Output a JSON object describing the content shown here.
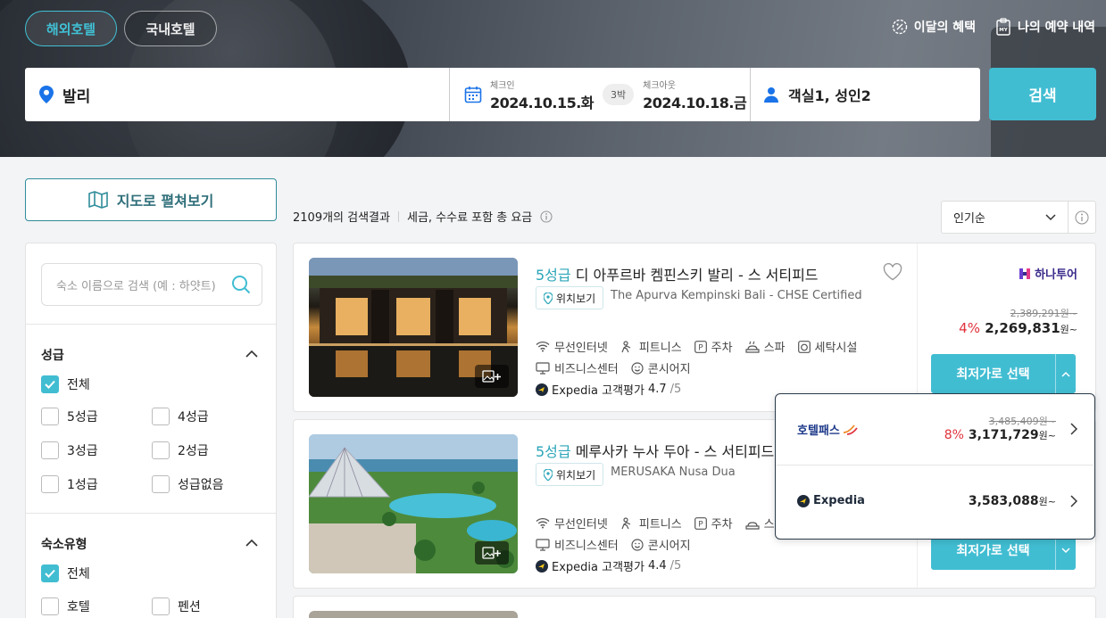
{
  "tabs": [
    {
      "label": "해외호텔",
      "active": true
    },
    {
      "label": "국내호텔",
      "active": false
    }
  ],
  "top_links": {
    "benefits": "이달의 혜택",
    "reservations": "나의 예약 내역",
    "reservations_icon_text": "MY"
  },
  "search": {
    "destination": "발리",
    "checkin_label": "체크인",
    "checkin": "2024.10.15.화",
    "nights": "3박",
    "checkout_label": "체크아웃",
    "checkout": "2024.10.18.금",
    "guests": "객실1, 성인2",
    "button": "검색"
  },
  "map_button": "지도로 펼쳐보기",
  "filters": {
    "name_placeholder": "숙소 이름으로 검색 (예 : 하얏트)",
    "grade": {
      "title": "성급",
      "options": [
        "전체",
        "5성급",
        "4성급",
        "3성급",
        "2성급",
        "1성급",
        "성급없음"
      ]
    },
    "type": {
      "title": "숙소유형",
      "options": [
        "전체",
        "호텔",
        "펜션"
      ]
    }
  },
  "results": {
    "count": "2109개의 검색결과",
    "price_note": "세금, 수수료 포함 총 요금",
    "sort": "인기순"
  },
  "hotels": [
    {
      "grade": "5성급",
      "name": " 디 아푸르바 켐핀스키 발리 - 스 서티피드",
      "map_chip": "위치보기",
      "english_name": "The Apurva Kempinski Bali - CHSE Certified",
      "amenities_row1": [
        "무선인터넷",
        "피트니스",
        "주차",
        "스파",
        "세탁시설"
      ],
      "amenities_row2": [
        "비즈니스센터",
        "콘시어지"
      ],
      "rating_source": "Expedia 고객평가",
      "rating": "4.7",
      "rating_max": "/5",
      "provider": "하나투어",
      "original_price": "2,389,291원~",
      "discount": "4%",
      "price": "2,269,831",
      "price_unit": "원~",
      "best_button": "최저가로 선택"
    },
    {
      "grade": "5성급",
      "name": " 메루사카 누사 두아 - 스 서티피드",
      "map_chip": "위치보기",
      "english_name": "MERUSAKA Nusa Dua",
      "amenities_row1": [
        "무선인터넷",
        "피트니스",
        "주차",
        "스"
      ],
      "amenities_row2": [
        "비즈니스센터",
        "콘시어지"
      ],
      "rating_source": "Expedia 고객평가",
      "rating": "4.4",
      "rating_max": "/5",
      "best_button": "최저가로 선택"
    }
  ],
  "popup": [
    {
      "provider": "호텔패스",
      "original_price": "3,485,409원~",
      "discount": "8%",
      "price": "3,171,729",
      "price_unit": "원~"
    },
    {
      "provider": "Expedia",
      "price": "3,583,088",
      "price_unit": "원~"
    }
  ],
  "colors": {
    "accent": "#41bdd2",
    "discount": "#e0323c",
    "grade": "#2aa5b8"
  }
}
